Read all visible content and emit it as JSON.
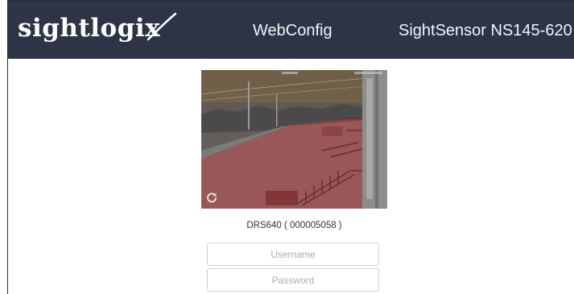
{
  "header": {
    "logo_text": "sightlogix",
    "nav_webconfig": "WebConfig",
    "product": "SightSensor NS145-620"
  },
  "camera": {
    "thumbnail": "thermal camera scene with red detection zone overlay",
    "device_label": "DRS640 ( 000005058 )"
  },
  "login": {
    "username_placeholder": "Username",
    "password_placeholder": "Password"
  },
  "colors": {
    "header_bg": "#2c3445",
    "overlay_red": "#b23a3a"
  }
}
